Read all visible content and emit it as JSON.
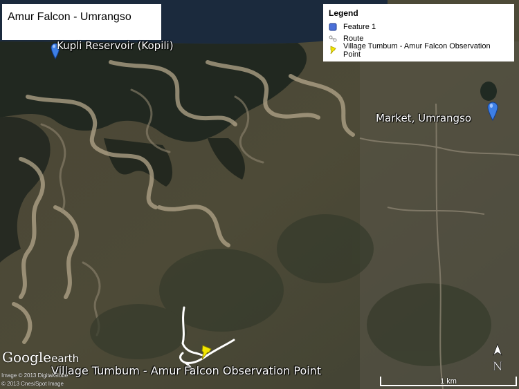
{
  "title": "Amur Falcon - Umrangso",
  "legend": {
    "title": "Legend",
    "items": [
      {
        "label": "Feature 1",
        "icon": "blue-square-icon"
      },
      {
        "label": "Route",
        "icon": "route-icon"
      },
      {
        "label": "Village Tumbum - Amur Falcon Observation Point",
        "icon": "yellow-pushpin-icon"
      }
    ]
  },
  "places": {
    "reservoir": "Kupli Reservoir (Kopili)",
    "market": "Market, Umrangso",
    "village": "Village Tumbum - Amur Falcon Observation Point"
  },
  "branding": {
    "google": "Google",
    "earth": "earth"
  },
  "copyright": [
    "Image © 2013 DigitalGlobe",
    "© 2013 Cnes/Spot Image"
  ],
  "north_label": "N",
  "scale_label": "1 km",
  "colors": {
    "water": "#1b2a3d",
    "pin_blue": "#3d7fe6",
    "pin_yellow": "#f2e600",
    "route": "#ffffff"
  }
}
